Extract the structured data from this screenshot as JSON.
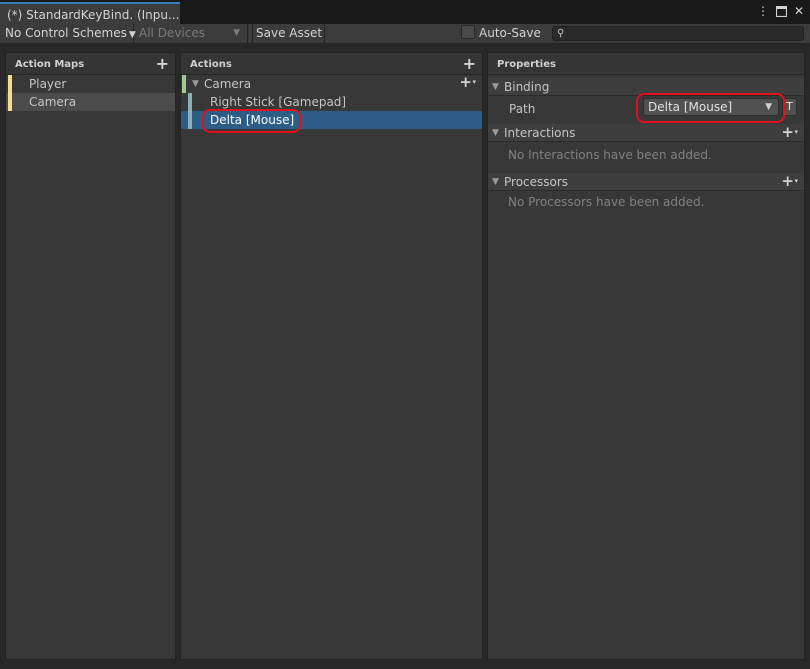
{
  "window": {
    "tab_title": "(*) StandardKeyBind. (Inpu..."
  },
  "toolbar": {
    "control_schemes": "No Control Schemes",
    "devices": "All Devices",
    "save_asset": "Save Asset",
    "auto_save": "Auto-Save",
    "search_value": ""
  },
  "action_maps": {
    "header": "Action Maps",
    "items": [
      {
        "label": "Player",
        "selected": false
      },
      {
        "label": "Camera",
        "selected": true
      }
    ]
  },
  "actions": {
    "header": "Actions",
    "group": "Camera",
    "bindings": [
      {
        "label": "Right Stick [Gamepad]",
        "selected": false
      },
      {
        "label": "Delta [Mouse]",
        "selected": true
      }
    ]
  },
  "properties": {
    "header": "Properties",
    "binding_section": "Binding",
    "path_label": "Path",
    "path_value": "Delta [Mouse]",
    "t_button": "T",
    "interactions_section": "Interactions",
    "interactions_empty": "No Interactions have been added.",
    "processors_section": "Processors",
    "processors_empty": "No Processors have been added."
  },
  "colors": {
    "action_map_bar": "#f2df8c",
    "action_group_bar": "#a3c992",
    "binding_bar": "#8ab1b8",
    "selection": "#2c5d87",
    "annotation": "#e0111c"
  }
}
